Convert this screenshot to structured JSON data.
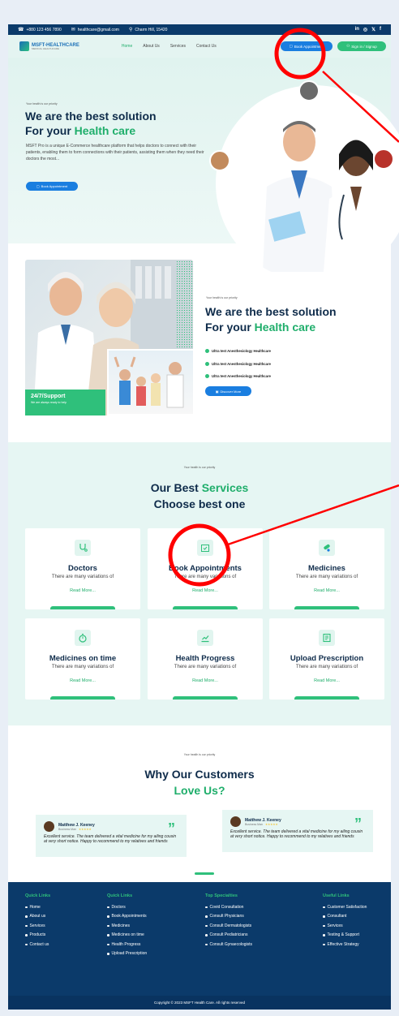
{
  "topbar": {
    "phone": "+880 123 456 7890",
    "email": "healthcare@gmail.com",
    "location": "Charm Hill, 15420",
    "social": [
      "in",
      "◎",
      "𝕏",
      "f"
    ]
  },
  "nav": {
    "brand": "MSFT-HEALTHCARE",
    "brand_sub": "MEDICAL HEALTHCARE",
    "menu": [
      "Home",
      "About Us",
      "Services",
      "Contact Us"
    ],
    "book_button": "Book Appointment",
    "signin_button": "Sign in / Signup"
  },
  "hero": {
    "eyebrow": "Your health is our priority",
    "title_line1": "We are the best solution",
    "title_line2_prefix": "For your ",
    "title_line2_highlight": "Health care",
    "description": "MSFT Pro is a unique E-Commerce healthcare platform that helps doctors to connect with their patients, enabling them to form connections with their patients, assisting them when they need their doctors the most...",
    "cta": "Book Appointment"
  },
  "about": {
    "support_title": "24/7/Support",
    "support_sub": "We are always ready to help",
    "eyebrow": "Your health is our priority",
    "title_line1": "We are the best solution",
    "title_line2_prefix": "For your ",
    "title_line2_highlight": "Health care",
    "list": [
      "Ultra test Anesthesiology Healthcare",
      "Ultra test Anesthesiology Healthcare",
      "Ultra test Anesthesiology Healthcare"
    ],
    "button": "Discover More"
  },
  "services": {
    "eyebrow": "Your health is our priority",
    "title_prefix": "Our Best ",
    "title_highlight": "Services",
    "subtitle": "Choose best one",
    "cards": [
      {
        "name": "Doctors",
        "desc": "There are many variations of",
        "more": "Read More...",
        "icon": "stethoscope-icon"
      },
      {
        "name": "Book Appointments",
        "desc": "There are many variations of",
        "more": "Read More...",
        "icon": "calendar-check-icon"
      },
      {
        "name": "Medicines",
        "desc": "There are many variations of",
        "more": "Read More...",
        "icon": "pills-icon"
      },
      {
        "name": "Medicines on time",
        "desc": "There are many variations of",
        "more": "Read More...",
        "icon": "stopwatch-icon"
      },
      {
        "name": "Health Progress",
        "desc": "There are many variations of",
        "more": "Read More...",
        "icon": "chart-line-icon"
      },
      {
        "name": "Upload Prescription",
        "desc": "There are many variations of",
        "more": "Read More...",
        "icon": "prescription-icon"
      }
    ]
  },
  "testimonials": {
    "eyebrow": "Your health is our priority",
    "title_line1": "Why Our Customers",
    "title_line2": "Love Us?",
    "items": [
      {
        "name": "Matthew J. Keeney",
        "role": "Business Man",
        "text": "Excellent service. The team delivered a vital medicine for my ailing cousin at very short notice. Happy to recommend to my relatives and friends"
      },
      {
        "name": "Matthew J. Keeney",
        "role": "Business Man",
        "text": "Excellent service. The team delivered a vital medicine for my ailing cousin at very short notice. Happy to recommend to my relatives and friends"
      }
    ]
  },
  "footer": {
    "columns": [
      {
        "title": "Quick Links",
        "items": [
          "Home",
          "About us",
          "Services",
          "Products",
          "Contact us"
        ]
      },
      {
        "title": "Quick Links",
        "items": [
          "Doctors",
          "Book Appointments",
          "Medicines",
          "Medicines on time",
          "Health Progress",
          "Upload Prescription"
        ]
      },
      {
        "title": "Top Specialties",
        "items": [
          "Covid Consultation",
          "Consult Physicians",
          "Consult Dermatologists",
          "Consult Pediatricians",
          "Consult Gynaecologists"
        ]
      },
      {
        "title": "Useful Links",
        "items": [
          "Customer Satisfaction",
          "Consultant",
          "Services",
          "Testing & Support",
          "Effective Strategy"
        ]
      }
    ],
    "copyright": "Copyright © 2023 MSFT Health Care. All rights reserved"
  },
  "colors": {
    "primary": "#1a7ee0",
    "accent": "#2fc07b",
    "navy": "#0b3a6a",
    "annotation": "#ff0000"
  }
}
